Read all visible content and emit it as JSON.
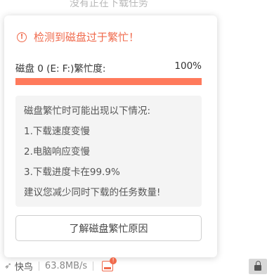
{
  "background": {
    "text": "没有正在下载任务"
  },
  "popup": {
    "warn_icon": "exclamation-circle-icon",
    "title": "检测到磁盘过于繁忙！",
    "disk_label": "磁盘 0 (E: F:)繁忙度:",
    "disk_value": "100%",
    "busy_fraction": 1.0,
    "accent_color": "#f0694b",
    "info_lines": [
      "磁盘繁忙时可能出现以下情况:",
      "1.下载速度变慢",
      "2.电脑响应变慢",
      "3.下载进度卡在99.9%",
      "建议您减少同时下载的任务数量!"
    ],
    "button_label": "了解磁盘繁忙原因"
  },
  "statusbar": {
    "brand_icon": "bird-icon",
    "brand": "快鸟",
    "speed": "63.8MB/s",
    "disk_icon": "disk-warning-icon",
    "lock_icon": "lock-icon"
  }
}
